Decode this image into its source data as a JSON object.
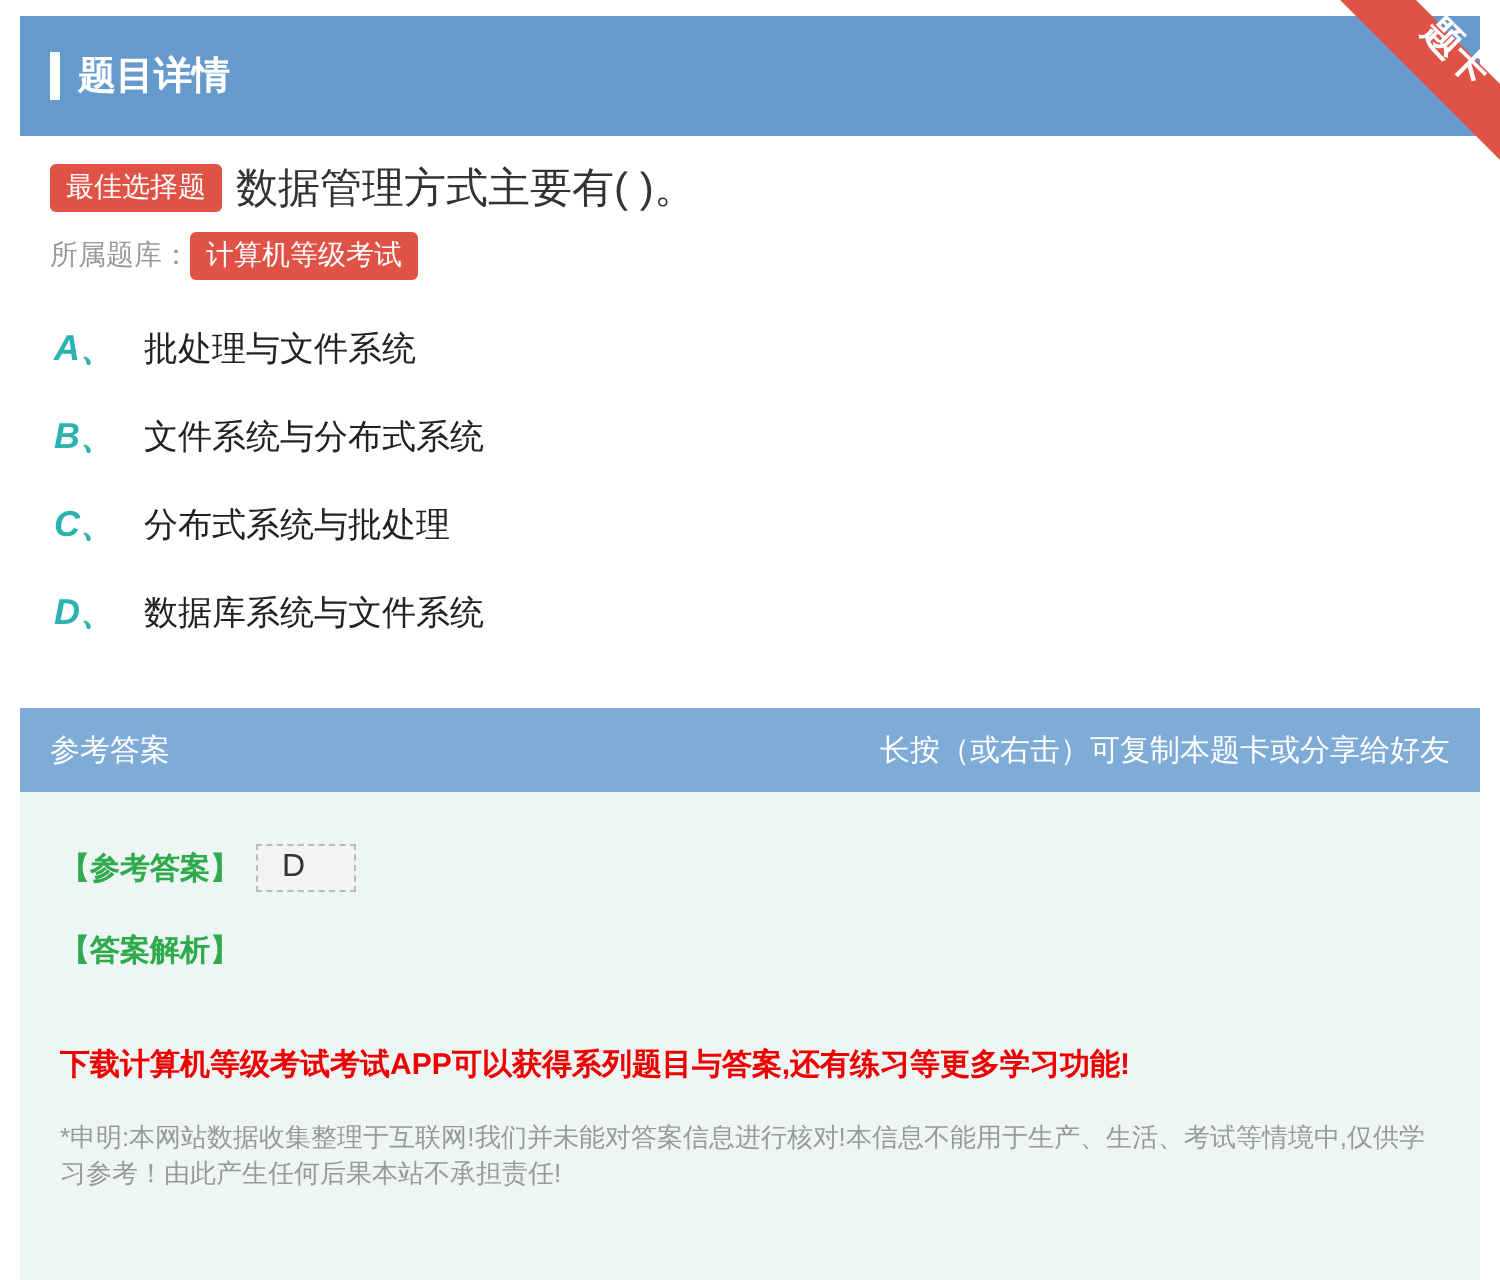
{
  "header": {
    "title": "题目详情",
    "ribbon": "题卡"
  },
  "question": {
    "type_badge": "最佳选择题",
    "text": "数据管理方式主要有( )。",
    "bank_label": "所属题库：",
    "bank": "计算机等级考试"
  },
  "options": [
    {
      "letter": "A、",
      "text": "批处理与文件系统"
    },
    {
      "letter": "B、",
      "text": "文件系统与分布式系统"
    },
    {
      "letter": "C、",
      "text": "分布式系统与批处理"
    },
    {
      "letter": "D、",
      "text": "数据库系统与文件系统"
    }
  ],
  "answer": {
    "title": "参考答案",
    "hint": "长按（或右击）可复制本题卡或分享给好友",
    "answer_label": "【参考答案】",
    "answer_value": "D",
    "analysis_label": "【答案解析】",
    "promo": "下载计算机等级考试考试APP可以获得系列题目与答案,还有练习等更多学习功能!",
    "disclaimer": "*申明:本网站数据收集整理于互联网!我们并未能对答案信息进行核对!本信息不能用于生产、生活、考试等情境中,仅供学习参考！由此产生任何后果本站不承担责任!"
  }
}
